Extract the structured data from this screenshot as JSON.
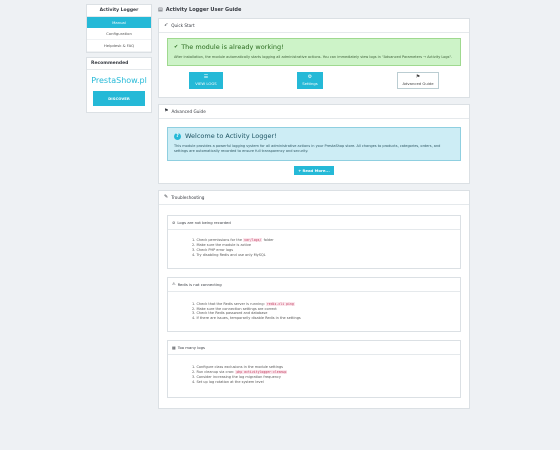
{
  "sidebar": {
    "title": "Activity Logger",
    "items": [
      {
        "label": "Manual",
        "active": true
      },
      {
        "label": "Configuration",
        "active": false
      },
      {
        "label": "Helpdesk & FAQ",
        "active": false
      }
    ],
    "promo": {
      "title": "Recommended",
      "logo_text": "PrestaShow.pl",
      "button": "DISCOVER"
    }
  },
  "page_title": "Activity Logger User Guide",
  "quick_start": {
    "heading": "Quick Start",
    "alert_title": "The module is already working!",
    "alert_text": "After installation, the module automatically starts logging all administrative actions. You can immediately view logs in \"Advanced Parameters → Activity Logs\".",
    "buttons": {
      "view_logs": "VIEW LOGS",
      "settings": "Settings",
      "advanced": "Advanced Guide"
    }
  },
  "advanced_guide": {
    "heading": "Advanced Guide",
    "alert_title": "Welcome to Activity Logger!",
    "alert_text": "This module provides a powerful logging system for all administrative actions in your PrestaShop store. All changes to products, categories, orders, and settings are automatically recorded to ensure full transparency and security.",
    "read_more": "Read More..."
  },
  "troubleshooting": {
    "heading": "Troubleshooting",
    "sections": [
      {
        "title": "Logs are not being recorded",
        "steps": [
          {
            "pre": "1. Check permissions for the ",
            "code": "var/logs/",
            "post": " folder"
          },
          {
            "pre": "2. Make sure the module is active",
            "code": "",
            "post": ""
          },
          {
            "pre": "3. Check PHP error logs",
            "code": "",
            "post": ""
          },
          {
            "pre": "4. Try disabling Redis and use only MySQL",
            "code": "",
            "post": ""
          }
        ]
      },
      {
        "title": "Redis is not connecting",
        "steps": [
          {
            "pre": "1. Check that the Redis server is running: ",
            "code": "redis-cli ping",
            "post": ""
          },
          {
            "pre": "2. Make sure the connection settings are correct",
            "code": "",
            "post": ""
          },
          {
            "pre": "3. Check the Redis password and database",
            "code": "",
            "post": ""
          },
          {
            "pre": "4. If there are issues, temporarily disable Redis in the settings",
            "code": "",
            "post": ""
          }
        ]
      },
      {
        "title": "Too many logs",
        "steps": [
          {
            "pre": "1. Configure class exclusions in the module settings",
            "code": "",
            "post": ""
          },
          {
            "pre": "2. Run cleanup via cron: ",
            "code": "php activitylogger:cleanup",
            "post": ""
          },
          {
            "pre": "3. Consider increasing the log migration frequency",
            "code": "",
            "post": ""
          },
          {
            "pre": "4. Set up log rotation at the system level",
            "code": "",
            "post": ""
          }
        ]
      }
    ]
  },
  "colors": {
    "primary": "#25b9d7",
    "success_bg": "#cdf3c8",
    "info_bg": "#cdedf5",
    "page_bg": "#eef1f4"
  }
}
